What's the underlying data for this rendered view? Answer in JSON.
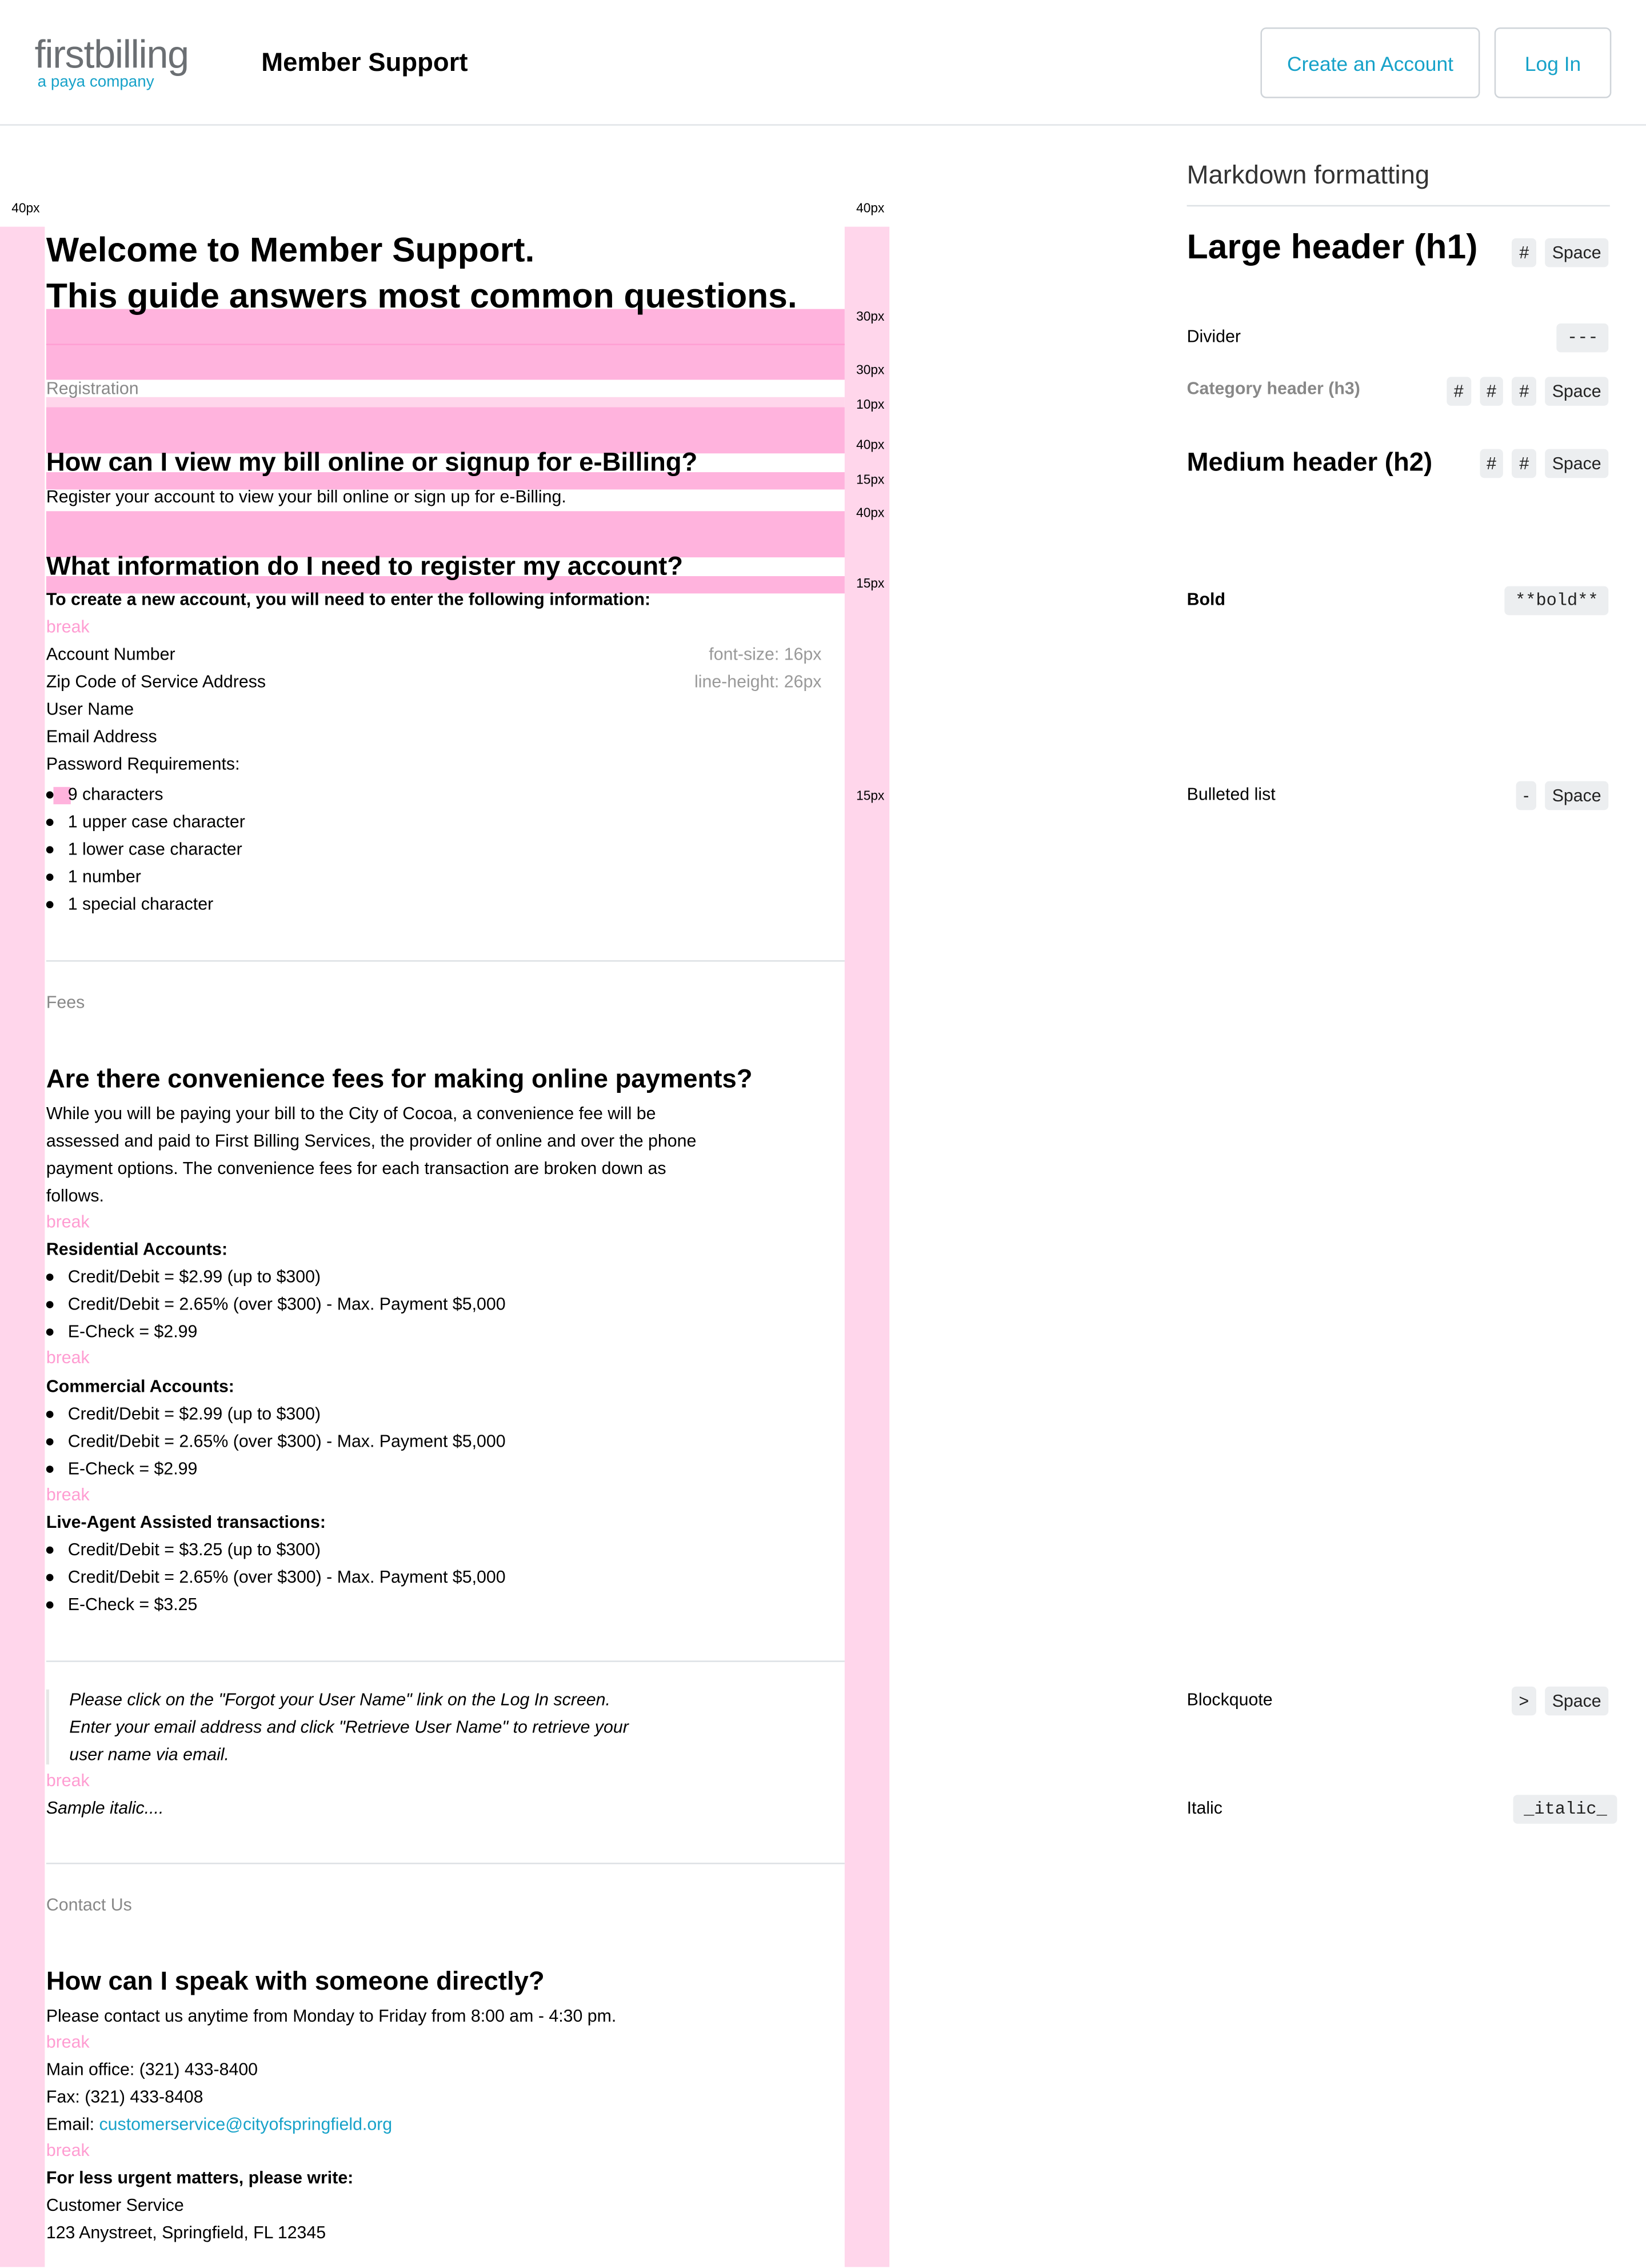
{
  "header": {
    "logo_first": "first",
    "logo_billing": "billing",
    "logo_tagline": "a paya company",
    "site_title": "Member Support",
    "create_account": "Create an Account",
    "login": "Log In"
  },
  "guides": {
    "margin_label": "40px",
    "spacing_labels": [
      "30px",
      "30px",
      "10px",
      "40px",
      "15px",
      "40px",
      "15px",
      "15px"
    ],
    "font_size_note": "font-size: 16px",
    "line_height_note": "line-height: 26px",
    "break": "break"
  },
  "welcome": {
    "line1": "Welcome to Member Support.",
    "line2": "This guide answers most common questions."
  },
  "registration": {
    "category": "Registration",
    "q1": "How can I view my bill online or signup for e-Billing?",
    "a1": "Register your account to view your bill online or sign up for e-Billing.",
    "q2": "What information do I need to register my account?",
    "intro": "To create a new account, you will need to enter the following information:",
    "fields": [
      "Account Number",
      "Zip Code of Service Address",
      "User Name",
      "Email Address",
      "Password Requirements:"
    ],
    "password_rules": [
      "9 characters",
      "1 upper case character",
      "1 lower case character",
      "1 number",
      "1 special character"
    ]
  },
  "fees": {
    "category": "Fees",
    "question": "Are there convenience fees for making online payments?",
    "answer_lines": [
      "While you will be paying your bill to the City of Cocoa, a convenience fee will be",
      "assessed and paid to First Billing Services, the provider of online and over the phone",
      "payment options. The convenience fees for each transaction are broken down as",
      "follows."
    ],
    "groups": [
      {
        "title": "Residential Accounts:",
        "items": [
          "Credit/Debit = $2.99 (up to $300)",
          "Credit/Debit = 2.65% (over $300) - Max. Payment $5,000",
          "E-Check = $2.99"
        ]
      },
      {
        "title": "Commercial Accounts:",
        "items": [
          "Credit/Debit = $2.99 (up to $300)",
          "Credit/Debit = 2.65% (over $300) - Max. Payment $5,000",
          "E-Check = $2.99"
        ]
      },
      {
        "title": "Live-Agent Assisted transactions:",
        "items": [
          "Credit/Debit = $3.25 (up to $300)",
          "Credit/Debit = 2.65% (over $300) - Max. Payment $5,000",
          "E-Check = $3.25"
        ]
      }
    ]
  },
  "quote": {
    "lines": [
      "Please click on the \"Forgot your User Name\" link on the Log In screen.",
      "Enter your email address and click \"Retrieve User Name\" to retrieve your",
      "user name via email."
    ],
    "italic_sample": "Sample italic...."
  },
  "contact": {
    "category": "Contact Us",
    "question": "How can I speak with someone directly?",
    "hours": "Please contact us anytime from Monday to Friday from 8:00 am - 4:30 pm.",
    "main_office": "Main office: (321) 433-8400",
    "fax": "Fax: (321) 433-8408",
    "email_label": "Email: ",
    "email": "customerservice@cityofspringfield.org",
    "write_title": "For less urgent matters, please write:",
    "addr1": "Customer Service",
    "addr2": "123 Anystreet, Springfield, FL 12345"
  },
  "sidebar": {
    "title": "Markdown formatting",
    "h1": "Large header (h1)",
    "divider": "Divider",
    "divider_key": "---",
    "h3": "Category header (h3)",
    "h2": "Medium header (h2)",
    "bold": "Bold",
    "bold_key": "**bold**",
    "bullets": "Bulleted list",
    "bullet_key": "-",
    "blockquote": "Blockquote",
    "quote_key": ">",
    "italic": "Italic",
    "italic_key": "_italic_",
    "hash": "#",
    "space": "Space"
  }
}
